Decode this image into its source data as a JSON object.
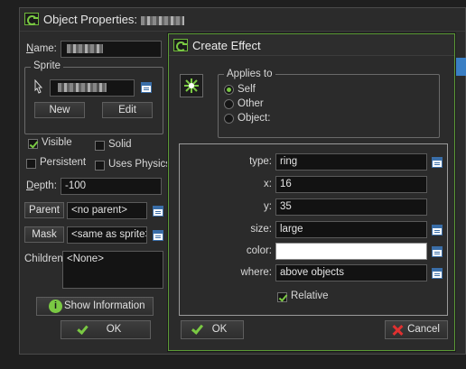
{
  "object_properties": {
    "title": "Object Properties:",
    "name_label": "Name:",
    "sprite_group": "Sprite",
    "new_button": "New",
    "edit_button": "Edit",
    "visible_label": "Visible",
    "solid_label": "Solid",
    "persistent_label": "Persistent",
    "uses_physics_label": "Uses Physics",
    "depth_label": "Depth:",
    "depth_value": "-100",
    "parent_button": "Parent",
    "parent_value": "<no parent>",
    "mask_button": "Mask",
    "mask_value": "<same as sprite>",
    "children_label": "Children:",
    "children_value": "<None>",
    "show_information_button": "Show Information",
    "ok_button": "OK",
    "checkbox_states": {
      "visible": true,
      "solid": false,
      "persistent": false,
      "uses_physics": false
    }
  },
  "create_effect": {
    "title": "Create Effect",
    "applies_to_group": "Applies to",
    "applies_to_options": [
      "Self",
      "Other",
      "Object:"
    ],
    "applies_to_selected": "Self",
    "fields": {
      "type_label": "type:",
      "type_value": "ring",
      "x_label": "x:",
      "x_value": "16",
      "y_label": "y:",
      "y_value": "35",
      "size_label": "size:",
      "size_value": "large",
      "color_label": "color:",
      "color_value": "",
      "where_label": "where:",
      "where_value": "above objects"
    },
    "relative_label": "Relative",
    "relative_checked": true,
    "ok_button": "OK",
    "cancel_button": "Cancel"
  },
  "colors": {
    "accent": "#7ac943",
    "window_bg": "#2b2b2b",
    "field_bg": "#141414",
    "cancel_red": "#e03030",
    "color_swatch": "#ffffff"
  },
  "icons": [
    "game-maker-logo",
    "sprite-pointer-icon",
    "menu-icon",
    "info-icon",
    "check-icon",
    "cancel-icon",
    "effect-sparkle-icon"
  ]
}
